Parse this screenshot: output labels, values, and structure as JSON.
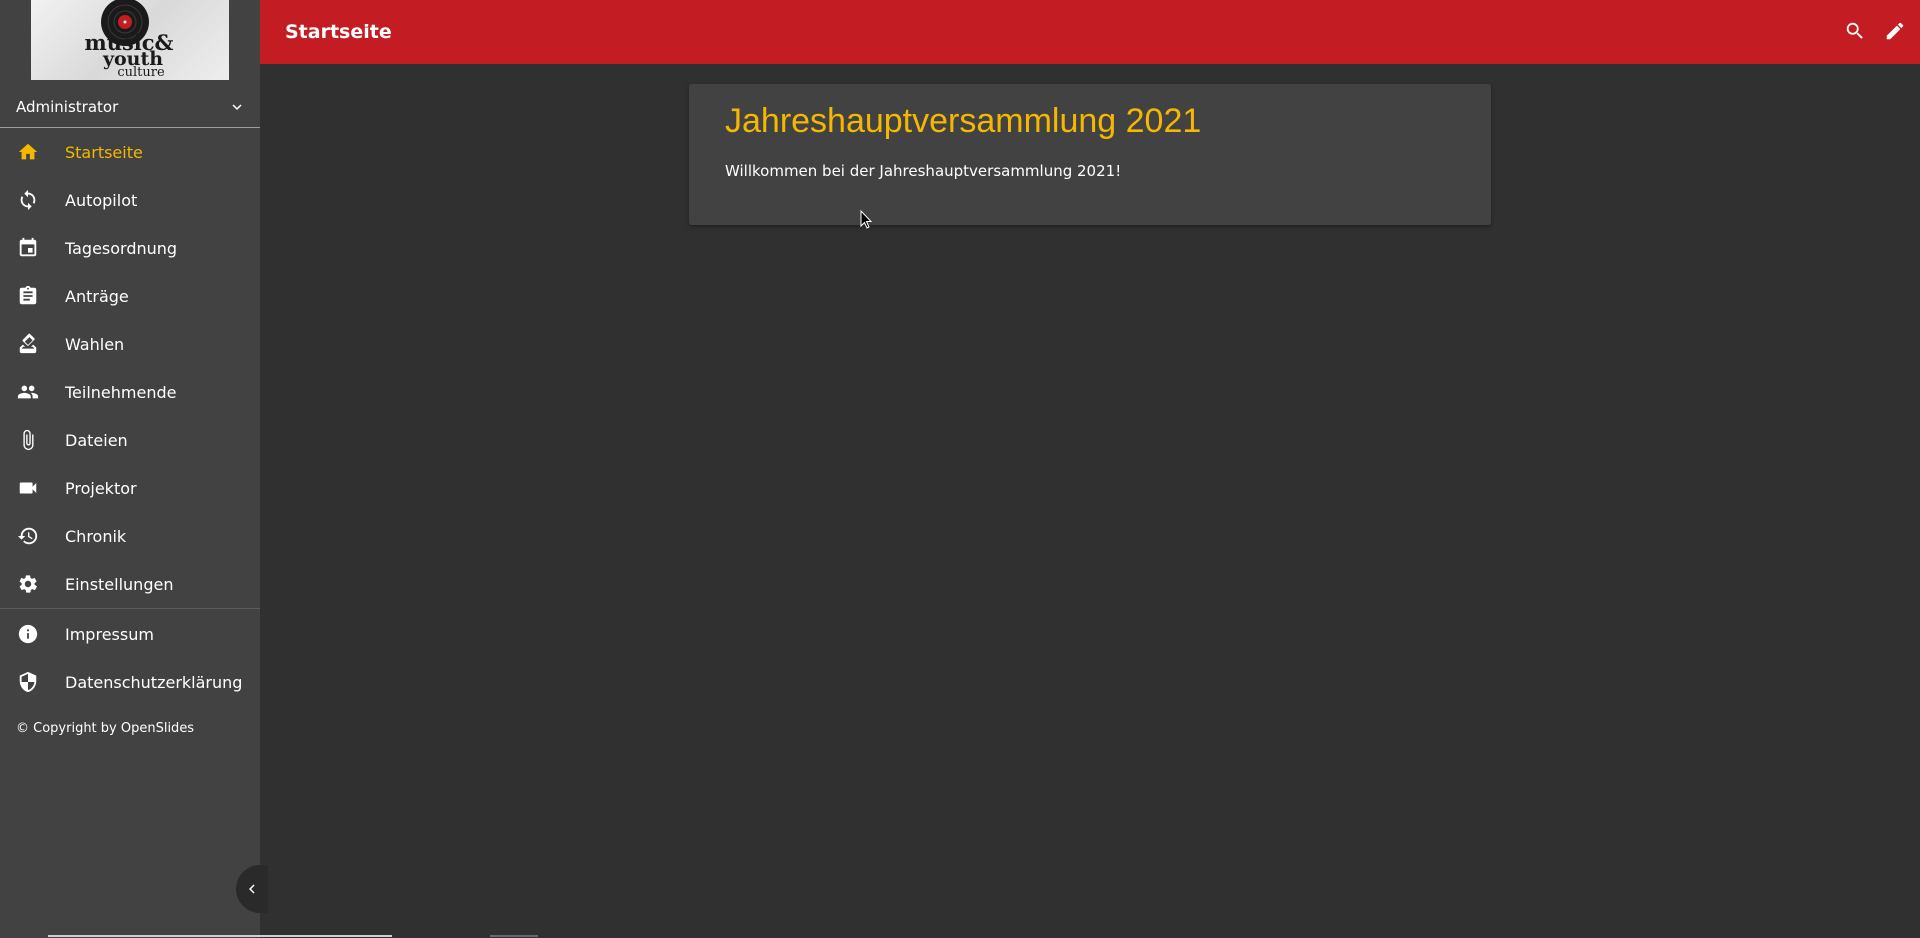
{
  "logo": {
    "line1": "music&",
    "line2": "youth",
    "line3": "culture",
    "colors": {
      "record": "#1a1a1a",
      "label": "#c31c23"
    }
  },
  "user_menu": {
    "name": "Administrator",
    "icon": "chevron-down-icon"
  },
  "nav": {
    "items": [
      {
        "label": "Startseite",
        "icon": "home-icon",
        "active": true
      },
      {
        "label": "Autopilot",
        "icon": "sync-icon"
      },
      {
        "label": "Tagesordnung",
        "icon": "calendar-icon"
      },
      {
        "label": "Anträge",
        "icon": "assignment-icon"
      },
      {
        "label": "Wahlen",
        "icon": "how-to-vote-icon"
      },
      {
        "label": "Teilnehmende",
        "icon": "people-icon"
      },
      {
        "label": "Dateien",
        "icon": "attach-file-icon"
      },
      {
        "label": "Projektor",
        "icon": "videocam-icon"
      },
      {
        "label": "Chronik",
        "icon": "history-icon"
      },
      {
        "label": "Einstellungen",
        "icon": "settings-icon"
      }
    ],
    "secondary": [
      {
        "label": "Impressum",
        "icon": "info-icon"
      },
      {
        "label": "Datenschutzerklärung",
        "icon": "shield-icon"
      }
    ]
  },
  "copyright": "© Copyright by OpenSlides",
  "header": {
    "title": "Startseite",
    "actions": [
      "search-icon",
      "edit-icon"
    ],
    "color": "#c31c23"
  },
  "card": {
    "title": "Jahreshauptversammlung 2021",
    "text": "Willkommen bei der Jahreshauptversammlung 2021!"
  },
  "colors": {
    "accent": "#f5b800",
    "background": "#303030",
    "surface": "#424242"
  }
}
